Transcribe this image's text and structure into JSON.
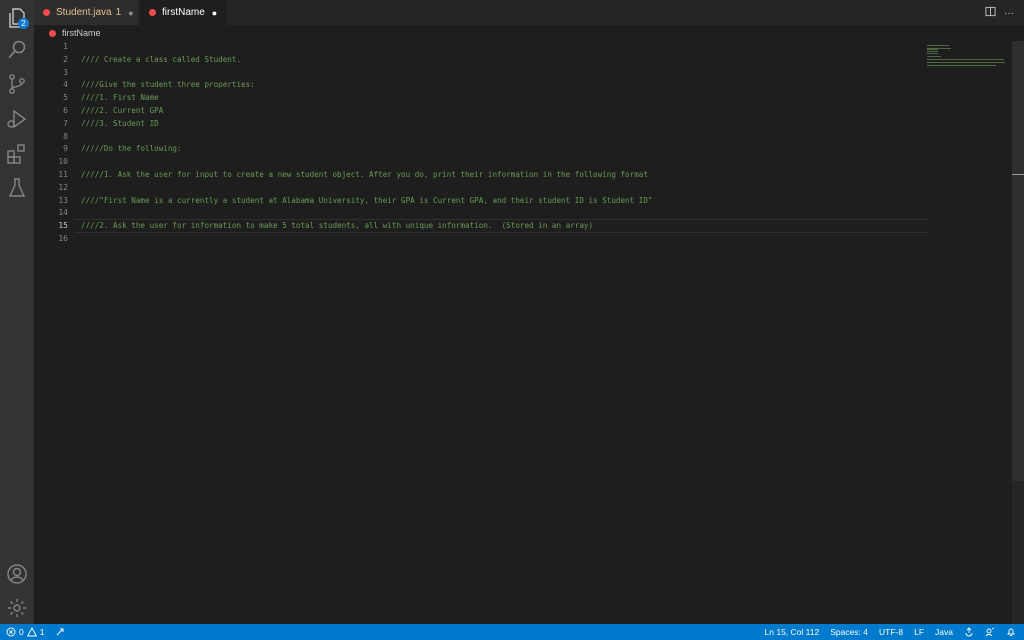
{
  "activity_bar": {
    "explorer_badge": "2",
    "icons": [
      "files-icon",
      "search-icon",
      "source-control-icon",
      "run-debug-icon",
      "extensions-icon",
      "testing-icon",
      "account-icon",
      "settings-gear-icon"
    ]
  },
  "tabs": [
    {
      "label": "Student.java",
      "problems": "1",
      "dirty_marker": "●",
      "active": false
    },
    {
      "label": "firstName",
      "problems": "",
      "dirty_marker": "●",
      "active": true
    }
  ],
  "tab_actions": {
    "split_editor_icon": "split-editor-icon",
    "more_label": "···"
  },
  "breadcrumb": {
    "label": "firstName"
  },
  "editor": {
    "current_line": 15,
    "line_numbers": [
      "1",
      "2",
      "3",
      "4",
      "5",
      "6",
      "7",
      "8",
      "9",
      "10",
      "11",
      "12",
      "13",
      "14",
      "15",
      "16"
    ],
    "lines": [
      "",
      "//// Create a class called Student.",
      "",
      "////Give the student three properties:",
      "////1. First Name",
      "////2. Current GPA",
      "////3. Student ID",
      "",
      "/////Do the following:",
      "",
      "/////1. Ask the user for input to create a new student object. After you do, print their information in the following format",
      "",
      "////\"First Name is a currently a student at Alabama University, their GPA is Current GPA, and their student ID is Student ID\"",
      "",
      "////2. Ask the user for information to make 5 total students, all with unique information.  (Stored in an array)",
      ""
    ]
  },
  "status": {
    "errors": "0",
    "warnings": "1",
    "position": "Ln 15, Col 112",
    "spaces": "Spaces: 4",
    "encoding": "UTF-8",
    "eol": "LF",
    "language": "Java"
  },
  "colors": {
    "accent": "#007acc",
    "comment": "#6a9955",
    "error": "#f14c4c",
    "modified_tab": "#e2c08d"
  }
}
